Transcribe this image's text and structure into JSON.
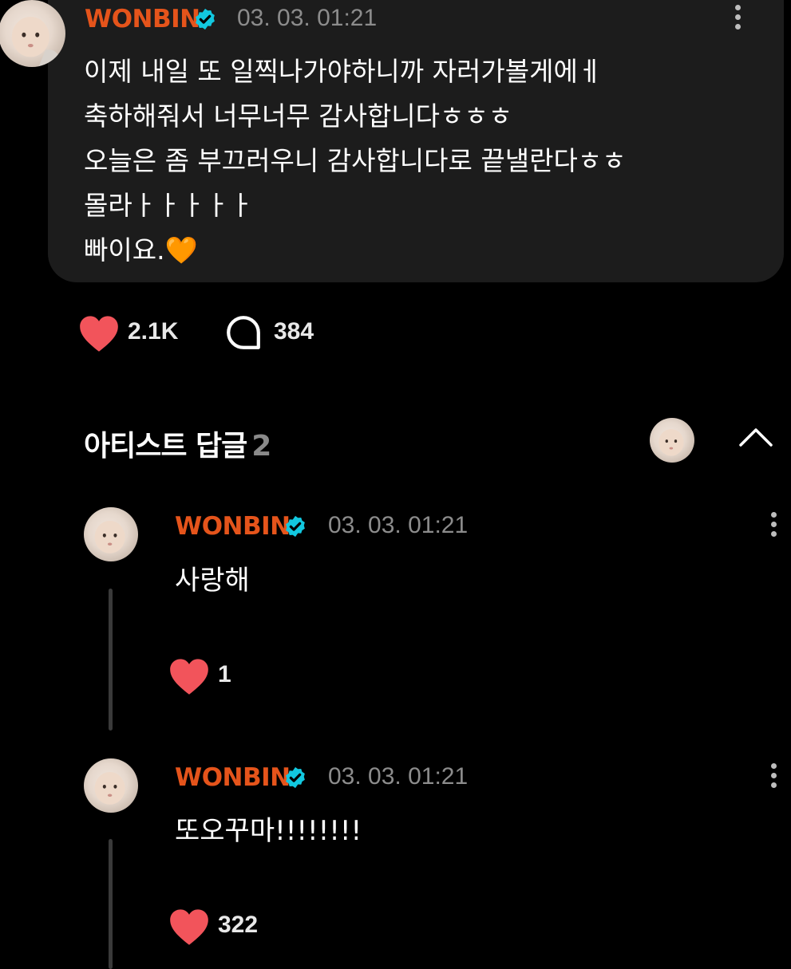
{
  "post": {
    "author": "WONBIN",
    "timestamp": "03. 03. 01:21",
    "text": "이제 내일 또 일찍나가야하니까 자러가볼게에ㅔ\n축하해줘서 너무너무 감사합니다ㅎㅎㅎ\n오늘은 좀 부끄러우니 감사합니다로 끝낼란다ㅎㅎ\n몰라ㅏㅏㅏㅏㅏ\n빠이요.🧡",
    "likes": "2.1K",
    "comments": "384"
  },
  "section": {
    "title": "아티스트 답글",
    "count": "2"
  },
  "replies": [
    {
      "author": "WONBIN",
      "timestamp": "03. 03. 01:21",
      "text": "사랑해",
      "likes": "1"
    },
    {
      "author": "WONBIN",
      "timestamp": "03. 03. 01:21",
      "text": "또오꾸마!!!!!!!!",
      "likes": "322"
    }
  ],
  "icons": {
    "like": "heart-icon",
    "comment": "speech-bubble-icon",
    "verified": "verified-badge-icon",
    "more": "more-vertical-icon",
    "collapse": "chevron-up-icon"
  },
  "colors": {
    "author": "#e5541b",
    "heart": "#f2545b",
    "verified": "#12c8e0",
    "bubble": "#1c1c1c",
    "timestamp": "#8c8c8c"
  }
}
